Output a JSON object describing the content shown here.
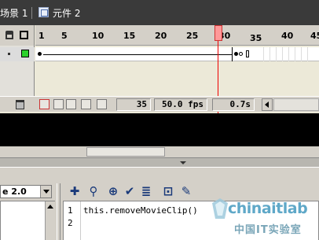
{
  "breadcrumb": {
    "scene": "场景 1",
    "symbol": "元件 2"
  },
  "timeline": {
    "ruler_labels": [
      "1",
      "5",
      "10",
      "15",
      "20",
      "25",
      "30",
      "35",
      "40",
      "45"
    ],
    "current_frame": "35",
    "frame_rate": "50.0 fps",
    "elapsed_time": "0.7s"
  },
  "actions": {
    "version_select": "e 2.0",
    "line_numbers": [
      "1",
      "2"
    ],
    "code_line_1": "this.removeMovieClip()"
  },
  "watermark": {
    "brand": "chinaitlab",
    "sub": "中国IT实验室"
  },
  "icons": {
    "lock": "lock-icon",
    "outline": "outline-icon",
    "trash": "trash-icon",
    "add": "add-statement-icon",
    "find": "find-icon",
    "target": "insert-target-path-icon",
    "check": "check-syntax-icon",
    "format": "auto-format-icon",
    "hint": "show-code-hint-icon",
    "debug": "debug-options-icon"
  },
  "colors": {
    "playhead": "#ff9999",
    "layer_outline": "#2bd12b",
    "breadcrumb_bg": "#3a3a3a"
  }
}
